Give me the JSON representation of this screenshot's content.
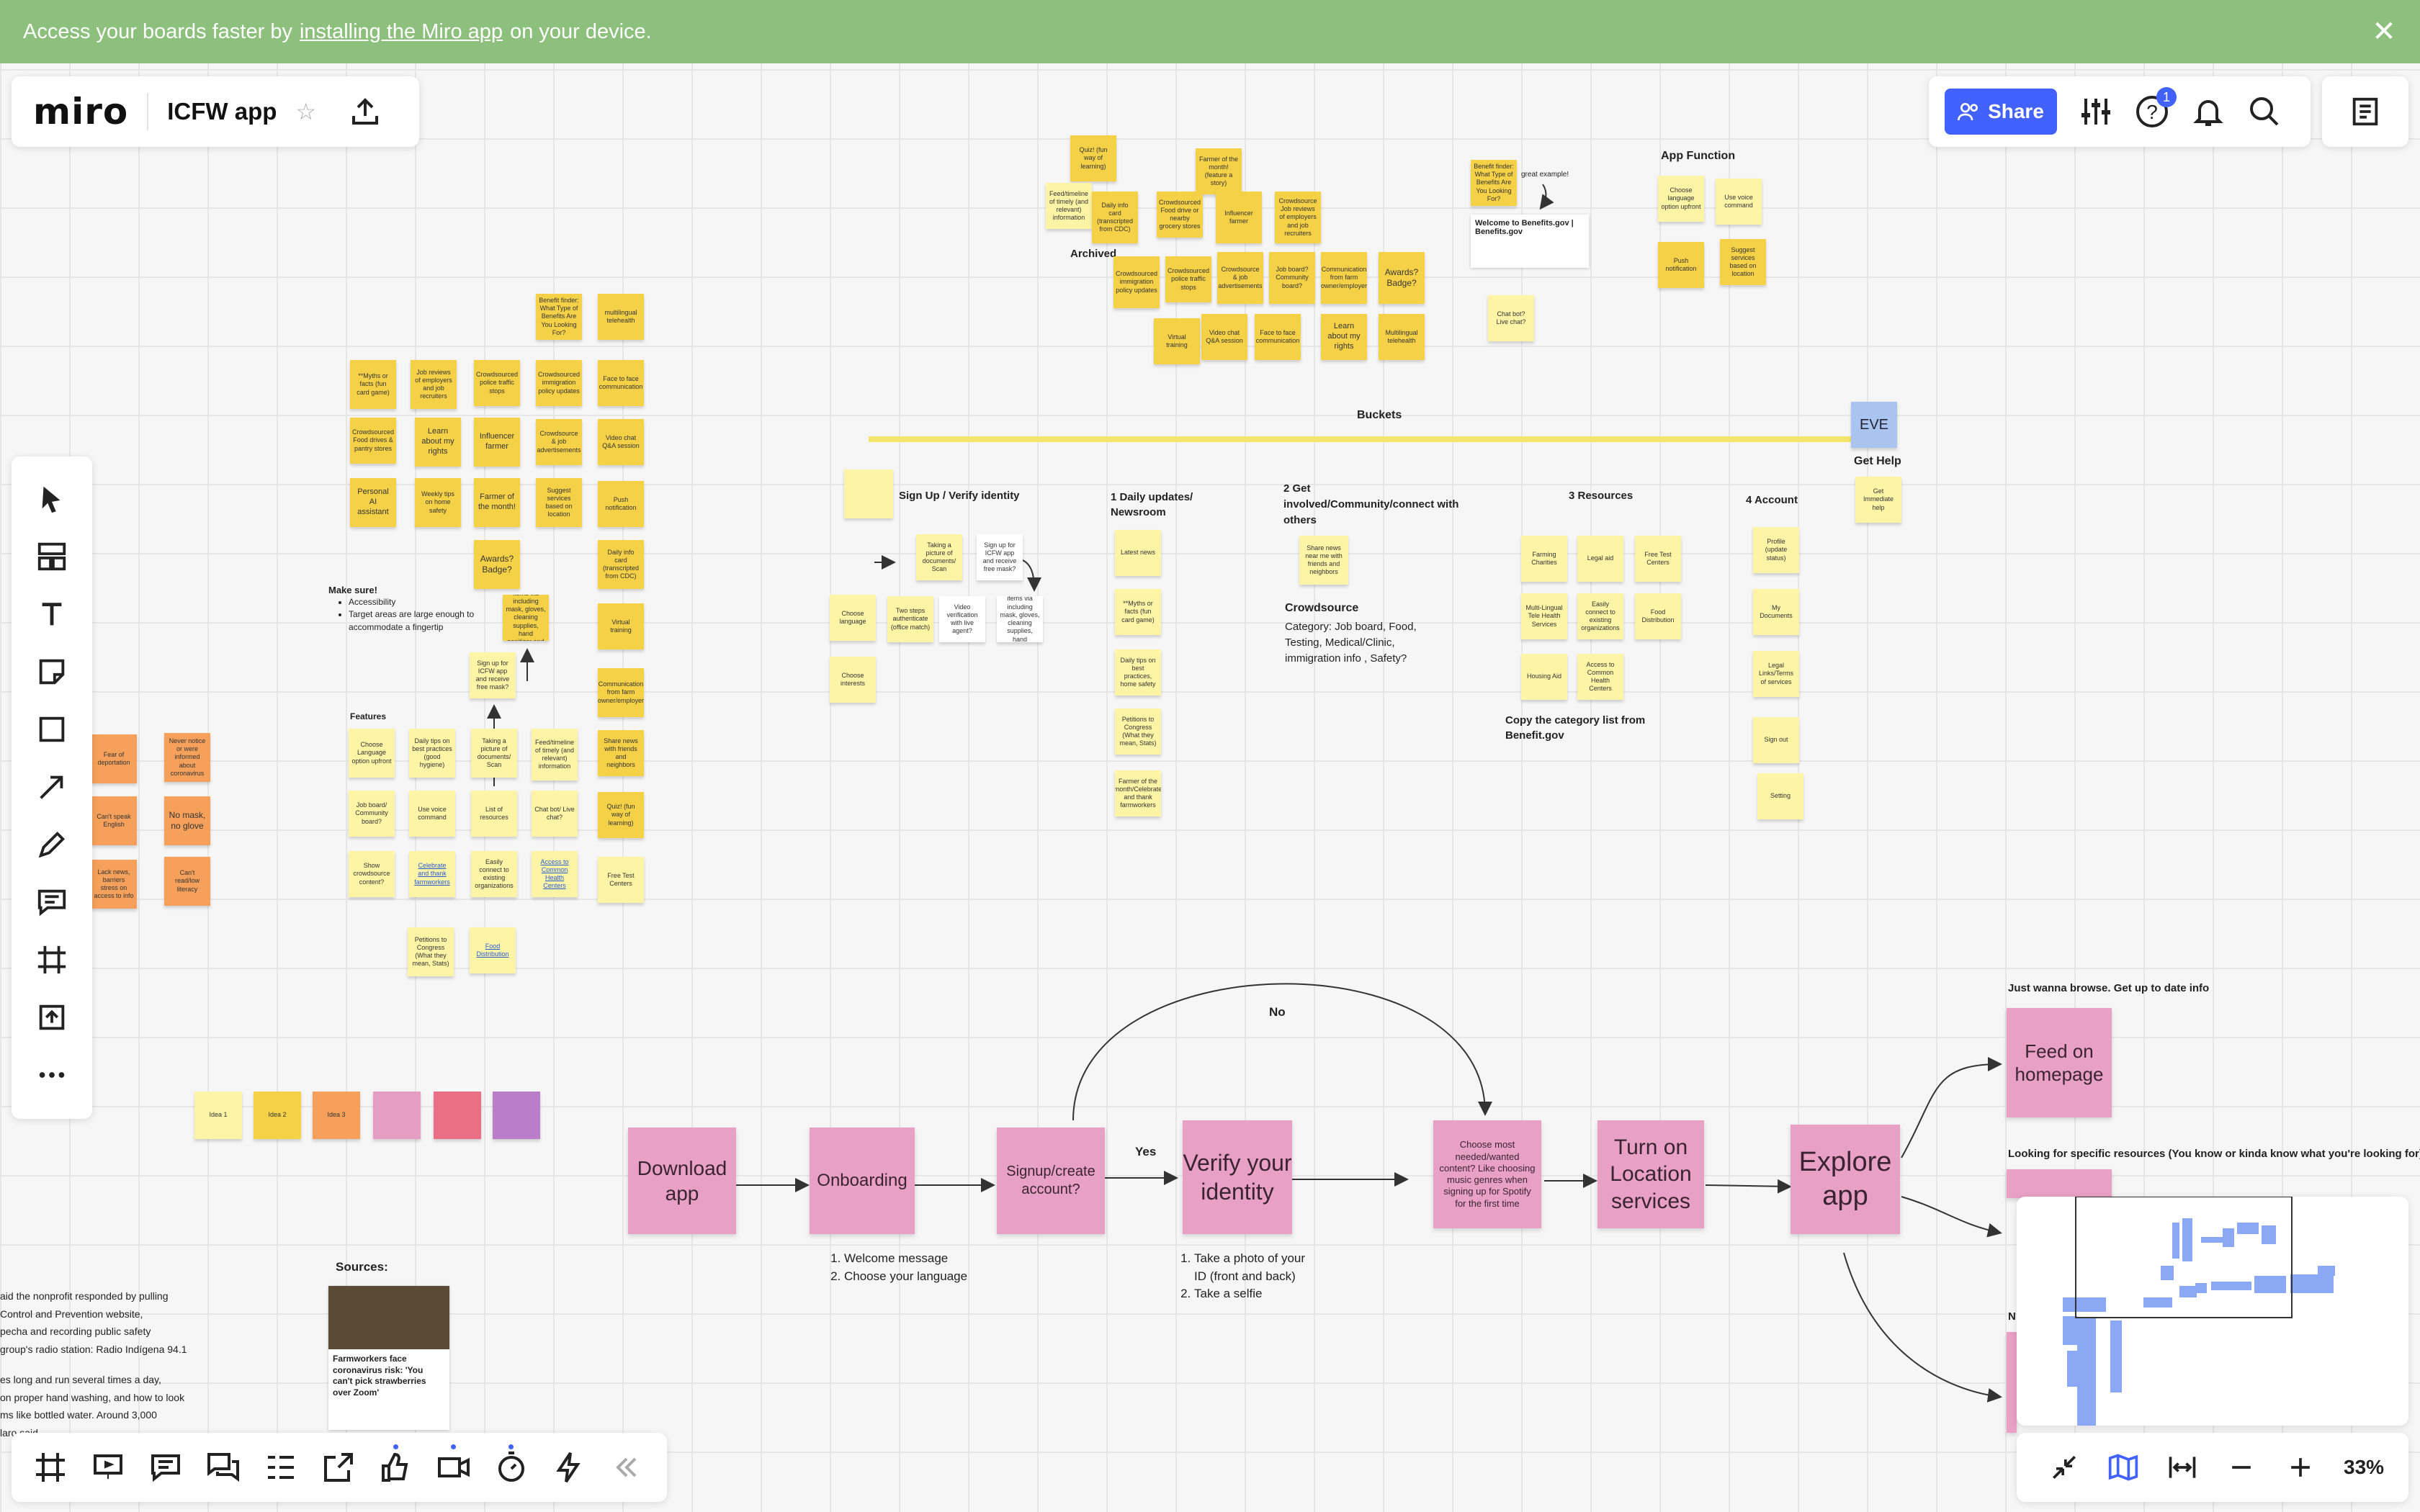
{
  "banner": {
    "prefix": "Access your boards faster by",
    "link": "installing the Miro app",
    "suffix": "on your device."
  },
  "header": {
    "logo": "miro",
    "board_name": "ICFW app",
    "share_label": "Share",
    "help_badge": "1"
  },
  "zoom": {
    "level": "33%"
  },
  "board": {
    "archived_label": "Archived",
    "buckets_label": "Buckets",
    "eve_label": "EVE",
    "get_help_label": "Get Help",
    "app_function_label": "App Function",
    "great_example": "great example!",
    "benefits_title": "Welcome to Benefits.gov | Benefits.gov",
    "sections": {
      "signup": "Sign Up / Verify identity",
      "daily": "1 Daily updates/ Newsroom",
      "community": "2 Get involved/Community/connect with others",
      "resources": "3 Resources",
      "account": "4 Account"
    },
    "crowdsource_title": "Crowdsource",
    "crowdsource_body": "Category: Job board, Food, Testing, Medical/Clinic, immigration info , Safety?",
    "copy_category": "Copy the category list from Benefit.gov",
    "make_sure_title": "Make sure!",
    "make_sure_items": [
      "Accessibility",
      "Target areas are large enough to accommodate a fingertip"
    ],
    "features_label": "Features",
    "sources_label": "Sources:",
    "sources_article_title": "Farmworkers face coronavirus risk: 'You can't pick strawberries over Zoom'",
    "sources_lines": [
      "aid the nonprofit responded by pulling",
      "Control and Prevention website,",
      "pecha and recording public safety",
      "group's radio station: Radio Indígena 94.1",
      "es long and run several times a day,",
      "on proper hand washing, and how to look",
      "ms like bottled water. Around 3,000",
      "laro said."
    ],
    "stickies_upper": [
      "**Myths or facts (fun card game)",
      "Job reviews of employers and job recruiters",
      "Crowdsourced police traffic stops",
      "Crowdsourced immigration policy updates",
      "Face to face communication",
      "Crowdsourced Food drives & pantry stores",
      "Learn about my rights",
      "Influencer farmer",
      "Crowdsource & job advertisements",
      "Video chat Q&A session",
      "Personal AI assistant",
      "Weekly tips on home safety",
      "Farmer of the month!",
      "Suggest services based on location",
      "Push notification",
      "Awards? Badge?",
      "Daily info card (transcripted from CDC)",
      "Virtual training",
      "Communication from farm owner/employer",
      "Share news with friends and neighbors",
      "Quiz! (fun way of learning)",
      "Free Test Centers"
    ],
    "features_stickies": [
      "Choose Language option upfront",
      "Daily tips on best practices (good hygiene)",
      "Taking a picture of documents/ Scan",
      "Feed/timeline of timely (and relevant) information",
      "Job board/ Community board?",
      "Use voice command",
      "List of resources",
      "Chat bot/ Live chat?",
      "Show crowdsource content?",
      "Celebrate and thank farmworkers",
      "Easily connect to existing organizations",
      "Access to Common Health Centers",
      "Petitions to Congress (What they mean, Stats)",
      "Food Distribution"
    ],
    "orange_stickies": [
      "Fear of deportation",
      "Never notice or were informed about coronavirus",
      "Can't speak English",
      "No mask, no glove",
      "Lack news, barriers stress on access to info",
      "Can't read/low literacy"
    ],
    "ideas": [
      "Idea 1",
      "Idea 2",
      "Idea 3"
    ],
    "flow": {
      "download": "Download app",
      "onboarding": "Onboarding",
      "signup": "Signup/create account?",
      "verify": "Verify your identity",
      "choose": "Choose most needed/wanted content? Like choosing music genres when signing up for Spotify for the first time",
      "location": "Turn on Location services",
      "explore": "Explore app",
      "feed": "Feed on homepage",
      "yes": "Yes",
      "no": "No",
      "browse_caption": "Just wanna browse. Get up to date info",
      "looking_caption": "Looking for specific resources (You know or kinda know what you're looking for)",
      "onboarding_steps": [
        "Welcome message",
        "Choose your language"
      ],
      "verify_steps": [
        "Take a photo of your ID (front and back)",
        "Take a selfie"
      ],
      "cut_label": "N"
    }
  },
  "icons": [
    "select-icon",
    "templates-icon",
    "text-icon",
    "sticky-note-icon",
    "shape-icon",
    "arrow-icon",
    "pen-icon",
    "comment-icon",
    "frame-icon",
    "upload-icon",
    "more-icon"
  ]
}
